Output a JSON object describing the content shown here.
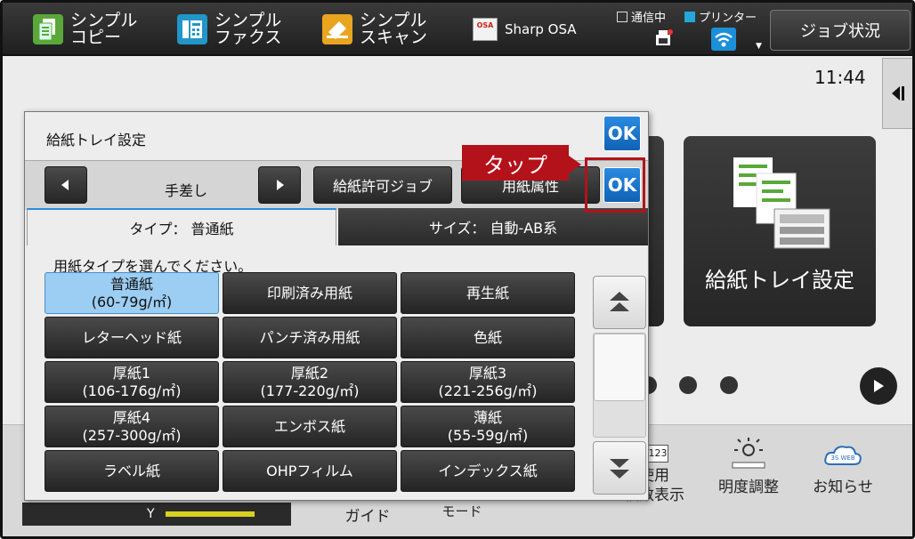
{
  "topbar": {
    "copy_label": "シンプル\nコピー",
    "fax_label": "シンプル\nファクス",
    "scan_label": "シンプル\nスキャン",
    "osa_icon_text": "OSA",
    "osa_label": "Sharp OSA",
    "status_comm": "通信中",
    "status_printer": "プリンター",
    "job_status_label": "ジョブ状況"
  },
  "home": {
    "clock": "11:44",
    "tile_label": "給紙トレイ設定",
    "bottom_items": [
      "ガイド",
      "モード",
      "使用\n枚数表示",
      "明度調整",
      "お知らせ"
    ],
    "counter_icon_text": "123",
    "web_icon_text": "3S WEB",
    "toner_label": "Y"
  },
  "dialog": {
    "title": "給紙トレイ設定",
    "ok_label": "OK",
    "tray_name": "手差し",
    "allowed_jobs_label": "給紙許可ジョブ",
    "paper_attr_label": "用紙属性",
    "tab_type": "タイプ：  普通紙",
    "tab_size": "サイズ：   自動-AB系",
    "prompt": "用紙タイプを選んでください。",
    "paper_types": [
      {
        "name": "普通紙",
        "sub": "(60-79g/㎡)",
        "selected": true
      },
      {
        "name": "印刷済み用紙",
        "sub": ""
      },
      {
        "name": "再生紙",
        "sub": ""
      },
      {
        "name": "レターヘッド紙",
        "sub": ""
      },
      {
        "name": "パンチ済み用紙",
        "sub": ""
      },
      {
        "name": "色紙",
        "sub": ""
      },
      {
        "name": "厚紙1",
        "sub": "(106-176g/㎡)"
      },
      {
        "name": "厚紙2",
        "sub": "(177-220g/㎡)"
      },
      {
        "name": "厚紙3",
        "sub": "(221-256g/㎡)"
      },
      {
        "name": "厚紙4",
        "sub": "(257-300g/㎡)"
      },
      {
        "name": "エンボス紙",
        "sub": ""
      },
      {
        "name": "薄紙",
        "sub": "(55-59g/㎡)"
      },
      {
        "name": "ラベル紙",
        "sub": ""
      },
      {
        "name": "OHPフィルム",
        "sub": ""
      },
      {
        "name": "インデックス紙",
        "sub": ""
      }
    ]
  },
  "callout": {
    "label": "タップ"
  },
  "colors": {
    "ok_blue": "#1a73d0",
    "callout_red": "#b3121b",
    "selected_blue": "#9ccdf2"
  }
}
